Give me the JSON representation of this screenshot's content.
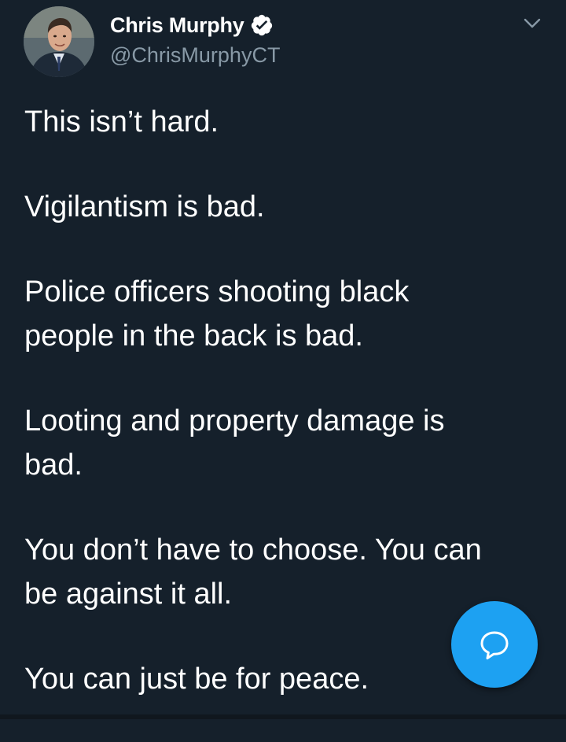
{
  "author": {
    "display_name": "Chris Murphy",
    "handle": "@ChrisMurphyCT",
    "verified": true,
    "avatar_icon": "avatar-photo"
  },
  "tweet": {
    "paragraphs": [
      "This isn’t hard.",
      "Vigilantism is bad.",
      "Police officers shooting black\npeople in the back is bad.",
      "Looting and property damage is\nbad.",
      "You don’t have to choose. You can\nbe against it all.",
      "You can just be for peace."
    ]
  },
  "icons": {
    "verified": "verified-badge-icon",
    "menu": "chevron-down-icon",
    "compose": "reply-bubble-icon"
  },
  "colors": {
    "background": "#15202b",
    "text": "#ffffff",
    "secondary_text": "#8899a6",
    "accent": "#1da1f2"
  }
}
